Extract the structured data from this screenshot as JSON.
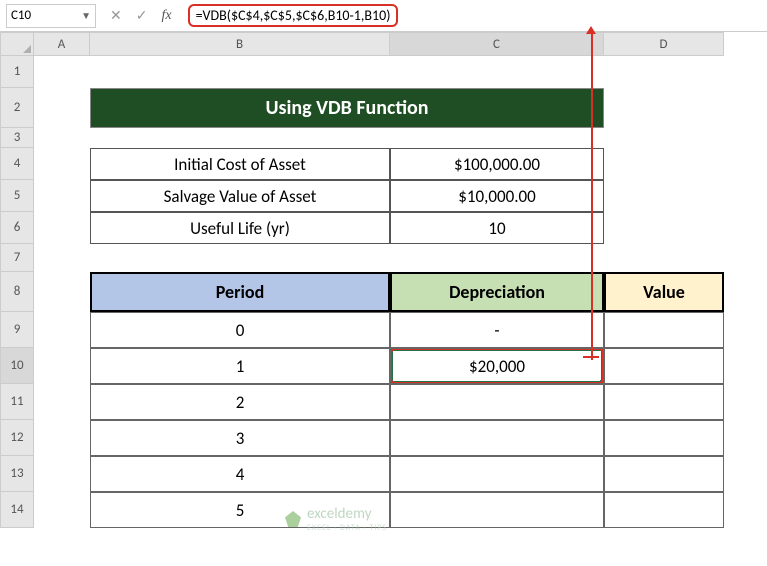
{
  "nameBox": "C10",
  "formula": "=VDB($C$4,$C$5,$C$6,B10-1,B10)",
  "columns": [
    "A",
    "B",
    "C",
    "D"
  ],
  "rows": [
    "1",
    "2",
    "3",
    "4",
    "5",
    "6",
    "7",
    "8",
    "9",
    "10",
    "11",
    "12",
    "13",
    "14"
  ],
  "title": "Using VDB Function",
  "params": {
    "initialLabel": "Initial Cost of Asset",
    "initialValue": "$100,000.00",
    "salvageLabel": "Salvage Value of Asset",
    "salvageValue": "$10,000.00",
    "lifeLabel": "Useful Life (yr)",
    "lifeValue": "10"
  },
  "headers": {
    "period": "Period",
    "dep": "Depreciation",
    "val": "Value"
  },
  "periods": [
    "0",
    "1",
    "2",
    "3",
    "4",
    "5"
  ],
  "depreciation": {
    "r9": "-",
    "r10": "$20,000"
  },
  "watermark": {
    "name": "exceldemy",
    "tag": "EXCEL · DATA · TIPS"
  },
  "chart_data": {
    "type": "table",
    "title": "Using VDB Function",
    "parameters": [
      {
        "label": "Initial Cost of Asset",
        "value": 100000
      },
      {
        "label": "Salvage Value of Asset",
        "value": 10000
      },
      {
        "label": "Useful Life (yr)",
        "value": 10
      }
    ],
    "columns": [
      "Period",
      "Depreciation",
      "Value"
    ],
    "rows": [
      {
        "Period": 0,
        "Depreciation": null,
        "Value": null
      },
      {
        "Period": 1,
        "Depreciation": 20000,
        "Value": null
      },
      {
        "Period": 2,
        "Depreciation": null,
        "Value": null
      },
      {
        "Period": 3,
        "Depreciation": null,
        "Value": null
      },
      {
        "Period": 4,
        "Depreciation": null,
        "Value": null
      },
      {
        "Period": 5,
        "Depreciation": null,
        "Value": null
      }
    ],
    "formula_C10": "=VDB($C$4,$C$5,$C$6,B10-1,B10)"
  }
}
